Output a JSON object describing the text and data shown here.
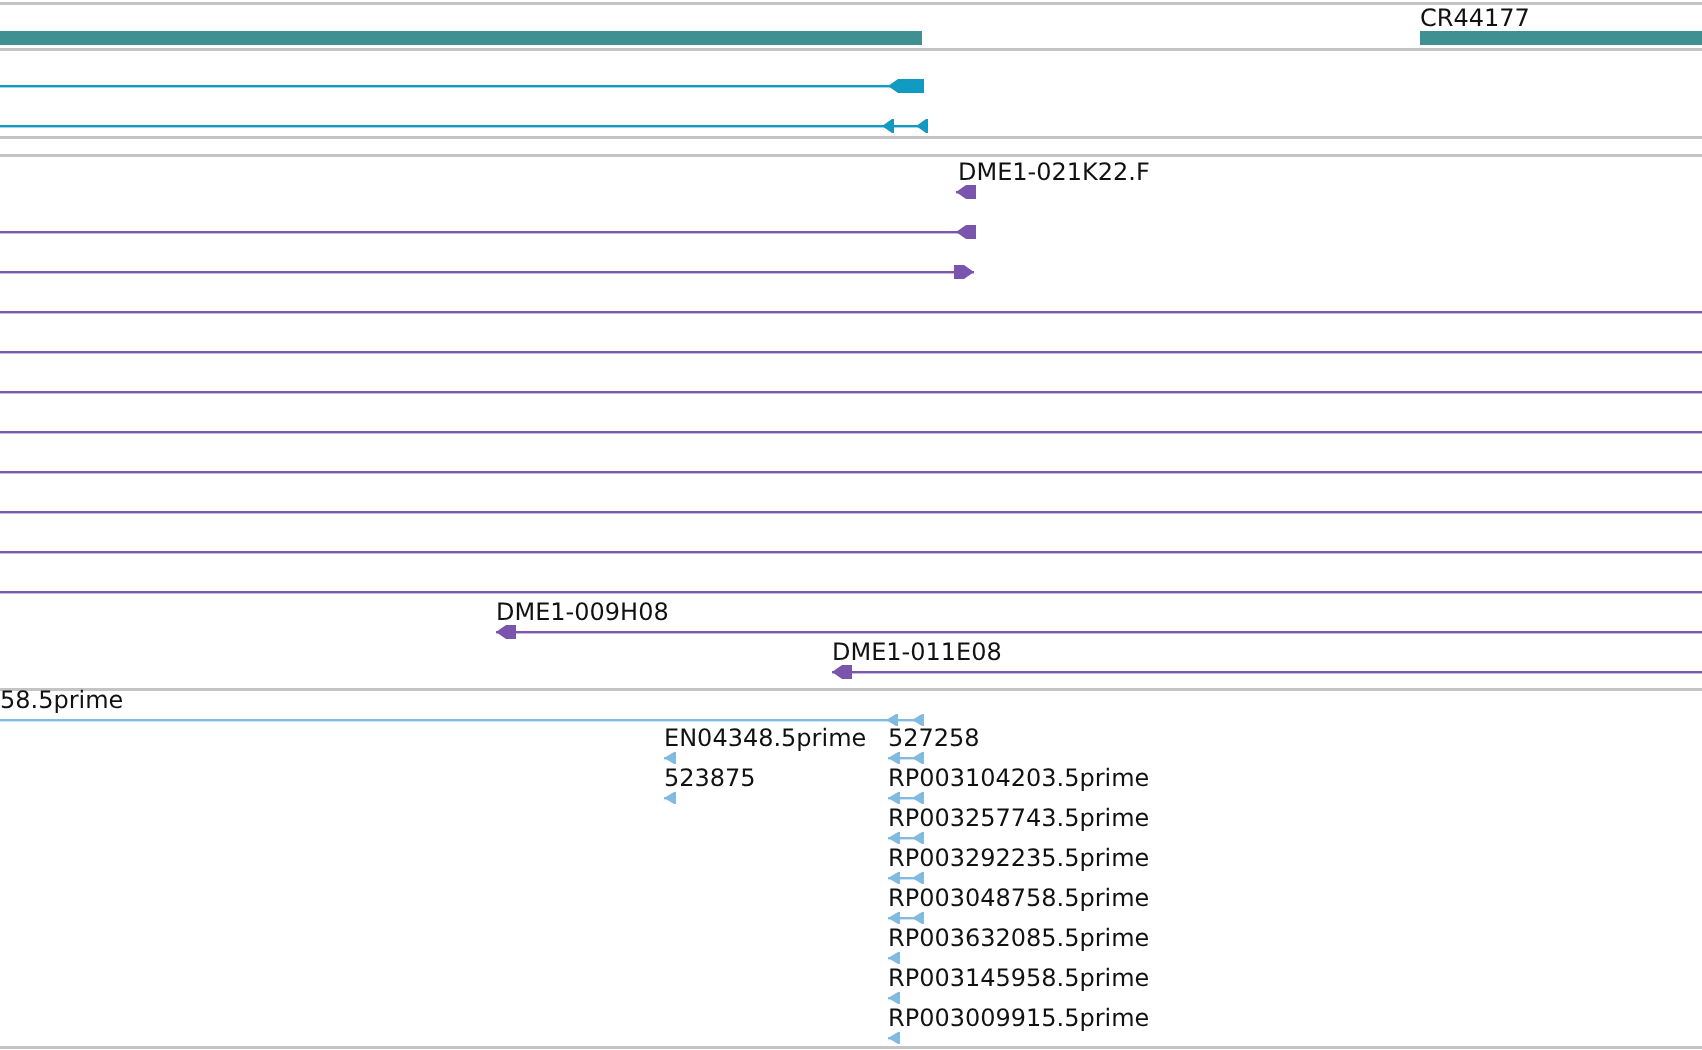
{
  "tracks": [
    {
      "color": "#3f9090",
      "features": [
        {
          "kind": "bar"
        },
        {
          "kind": "bar",
          "label": "CR44177"
        }
      ]
    },
    {
      "color": "#119ac2",
      "features": [
        {
          "kind": "reverse"
        },
        {
          "kind": "reverse"
        }
      ]
    },
    {
      "color": "#7b55ad",
      "features": [
        {
          "kind": "reverse",
          "label": "DME1-021K22.F"
        },
        {
          "kind": "reverse"
        },
        {
          "kind": "forward"
        },
        {
          "kind": "line"
        },
        {
          "kind": "line"
        },
        {
          "kind": "line"
        },
        {
          "kind": "line"
        },
        {
          "kind": "line"
        },
        {
          "kind": "line"
        },
        {
          "kind": "line"
        },
        {
          "kind": "line"
        },
        {
          "kind": "reverse",
          "label": "DME1-009H08"
        },
        {
          "kind": "reverse",
          "label": "DME1-011E08"
        }
      ]
    },
    {
      "color": "#80bbe0",
      "features": [
        {
          "kind": "reverse",
          "label": "58.5prime"
        },
        {
          "kind": "reverse",
          "label": "EN04348.5prime"
        },
        {
          "kind": "reverse",
          "label": "527258"
        },
        {
          "kind": "reverse",
          "label": "523875"
        },
        {
          "kind": "reverse",
          "label": "RP003104203.5prime"
        },
        {
          "kind": "reverse",
          "label": "RP003257743.5prime"
        },
        {
          "kind": "reverse",
          "label": "RP003292235.5prime"
        },
        {
          "kind": "reverse",
          "label": "RP003048758.5prime"
        },
        {
          "kind": "reverse",
          "label": "RP003632085.5prime"
        },
        {
          "kind": "reverse",
          "label": "RP003145958.5prime"
        },
        {
          "kind": "reverse",
          "label": "RP003009915.5prime"
        }
      ]
    }
  ]
}
